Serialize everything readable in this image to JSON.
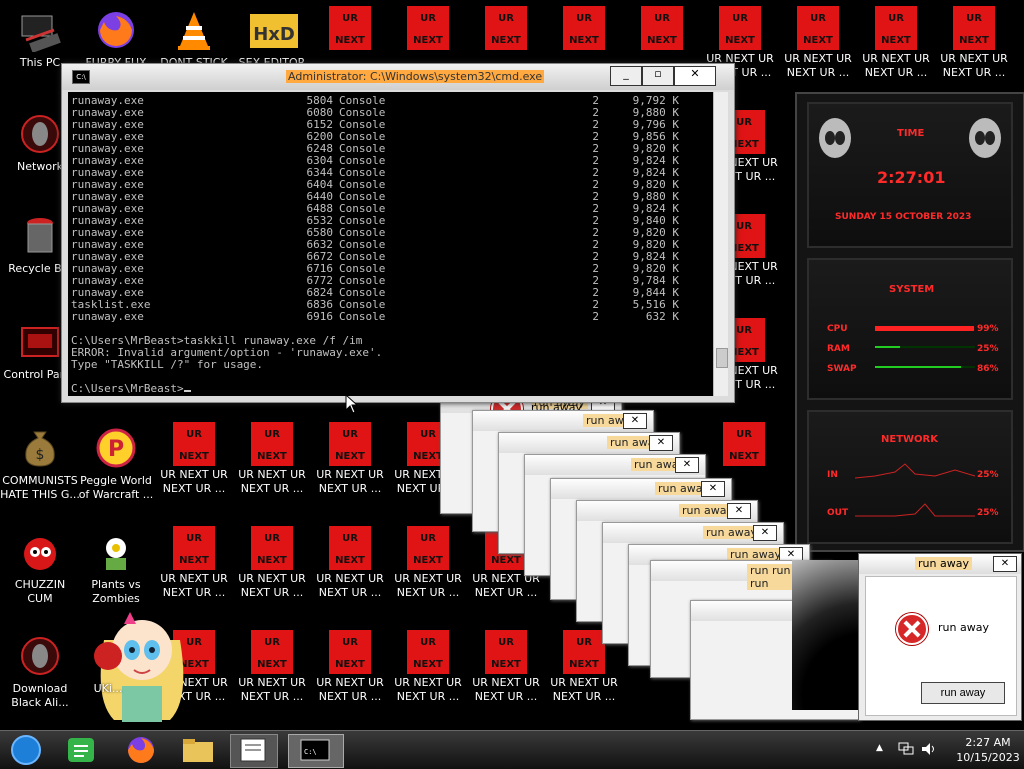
{
  "desktop": {
    "icons": [
      {
        "label": "This PC",
        "icon": "computer-icon"
      },
      {
        "label": "FURRY FUX",
        "icon": "firefox-icon"
      },
      {
        "label": "DONT STICK THIS IN YO...",
        "icon": "vlc-cone-icon"
      },
      {
        "label": "SEX EDITOR",
        "icon": "hxd-editor-icon"
      },
      {
        "label": "Network",
        "icon": "alien-network-icon"
      },
      {
        "label": "Recycle Bin",
        "icon": "recycle-bin-icon"
      },
      {
        "label": "Control Panel",
        "icon": "control-panel-icon"
      },
      {
        "label": "COMMUNISTS HATE THIS G...",
        "icon": "money-bag-icon"
      },
      {
        "label": "Peggle World of Warcraft ...",
        "icon": "peggle-icon"
      },
      {
        "label": "CHUZZIN CUM",
        "icon": "chuzzle-icon"
      },
      {
        "label": "Plants vs Zombies",
        "icon": "plants-vs-zombies-icon"
      },
      {
        "label": "Download Black Ali...",
        "icon": "alien-download-icon"
      },
      {
        "label": "UKi...",
        "icon": "app-icon"
      }
    ],
    "ur_top": "UR",
    "ur_bottom": "NEXT",
    "ur_label": "UR NEXT UR NEXT UR ...",
    "decor": "Deluxe"
  },
  "cmd": {
    "title": "Administrator: C:\\Windows\\system32\\cmd.exe",
    "rows": [
      [
        "runaway.exe",
        "5804",
        "Console",
        "2",
        "9,792 K"
      ],
      [
        "runaway.exe",
        "6080",
        "Console",
        "2",
        "9,880 K"
      ],
      [
        "runaway.exe",
        "6152",
        "Console",
        "2",
        "9,796 K"
      ],
      [
        "runaway.exe",
        "6200",
        "Console",
        "2",
        "9,856 K"
      ],
      [
        "runaway.exe",
        "6248",
        "Console",
        "2",
        "9,820 K"
      ],
      [
        "runaway.exe",
        "6304",
        "Console",
        "2",
        "9,824 K"
      ],
      [
        "runaway.exe",
        "6344",
        "Console",
        "2",
        "9,824 K"
      ],
      [
        "runaway.exe",
        "6404",
        "Console",
        "2",
        "9,820 K"
      ],
      [
        "runaway.exe",
        "6440",
        "Console",
        "2",
        "9,880 K"
      ],
      [
        "runaway.exe",
        "6488",
        "Console",
        "2",
        "9,824 K"
      ],
      [
        "runaway.exe",
        "6532",
        "Console",
        "2",
        "9,840 K"
      ],
      [
        "runaway.exe",
        "6580",
        "Console",
        "2",
        "9,820 K"
      ],
      [
        "runaway.exe",
        "6632",
        "Console",
        "2",
        "9,820 K"
      ],
      [
        "runaway.exe",
        "6672",
        "Console",
        "2",
        "9,824 K"
      ],
      [
        "runaway.exe",
        "6716",
        "Console",
        "2",
        "9,820 K"
      ],
      [
        "runaway.exe",
        "6772",
        "Console",
        "2",
        "9,784 K"
      ],
      [
        "runaway.exe",
        "6824",
        "Console",
        "2",
        "9,844 K"
      ],
      [
        "tasklist.exe",
        "6836",
        "Console",
        "2",
        "5,516 K"
      ],
      [
        "runaway.exe",
        "6916",
        "Console",
        "2",
        "632 K"
      ]
    ],
    "command": "C:\\Users\\MrBeast>taskkill runaway.exe /f /im",
    "error": "ERROR: Invalid argument/option - 'runaway.exe'.",
    "hint": "Type \"TASKKILL /?\" for usage.",
    "prompt": "C:\\Users\\MrBeast>"
  },
  "gadget": {
    "time_title": "TIME",
    "time": "2:27:01",
    "date": "SUNDAY 15 OCTOBER 2023",
    "system_title": "SYSTEM",
    "cpu_label": "CPU",
    "cpu_value": "99%",
    "cpu_level": 0.99,
    "ram_label": "RAM",
    "ram_value": "25%",
    "ram_level": 0.25,
    "swap_label": "SWAP",
    "swap_value": "86%",
    "swap_level": 0.86,
    "network_title": "NETWORK",
    "in_label": "IN",
    "in_value": "25%",
    "out_label": "OUT",
    "out_value": "25%"
  },
  "popup": {
    "title": "run away",
    "message": "run away",
    "button": "run away",
    "strip": "run run run run"
  },
  "taskbar": {
    "time": "2:27 AM",
    "date": "10/15/2023"
  }
}
